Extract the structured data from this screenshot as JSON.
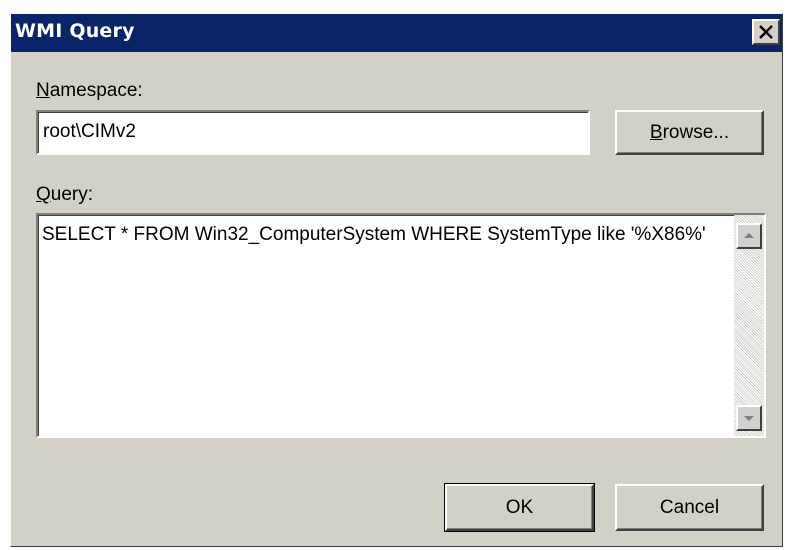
{
  "window": {
    "title": "WMI Query",
    "close_icon": "close-icon"
  },
  "namespace": {
    "label_underlined": "N",
    "label_rest": "amespace:",
    "value": "root\\CIMv2",
    "browse_underlined": "B",
    "browse_rest": "rowse..."
  },
  "query": {
    "label_underlined": "Q",
    "label_rest": "uery:",
    "text": "SELECT * FROM Win32_ComputerSystem WHERE SystemType like '%X86%'"
  },
  "buttons": {
    "ok_label": "OK",
    "cancel_label": "Cancel"
  },
  "icons": {
    "scroll_up": "scroll-up-arrow-icon",
    "scroll_down": "scroll-down-arrow-icon"
  },
  "colors": {
    "titlebar": "#0a246a",
    "face": "#d4d0c8"
  }
}
